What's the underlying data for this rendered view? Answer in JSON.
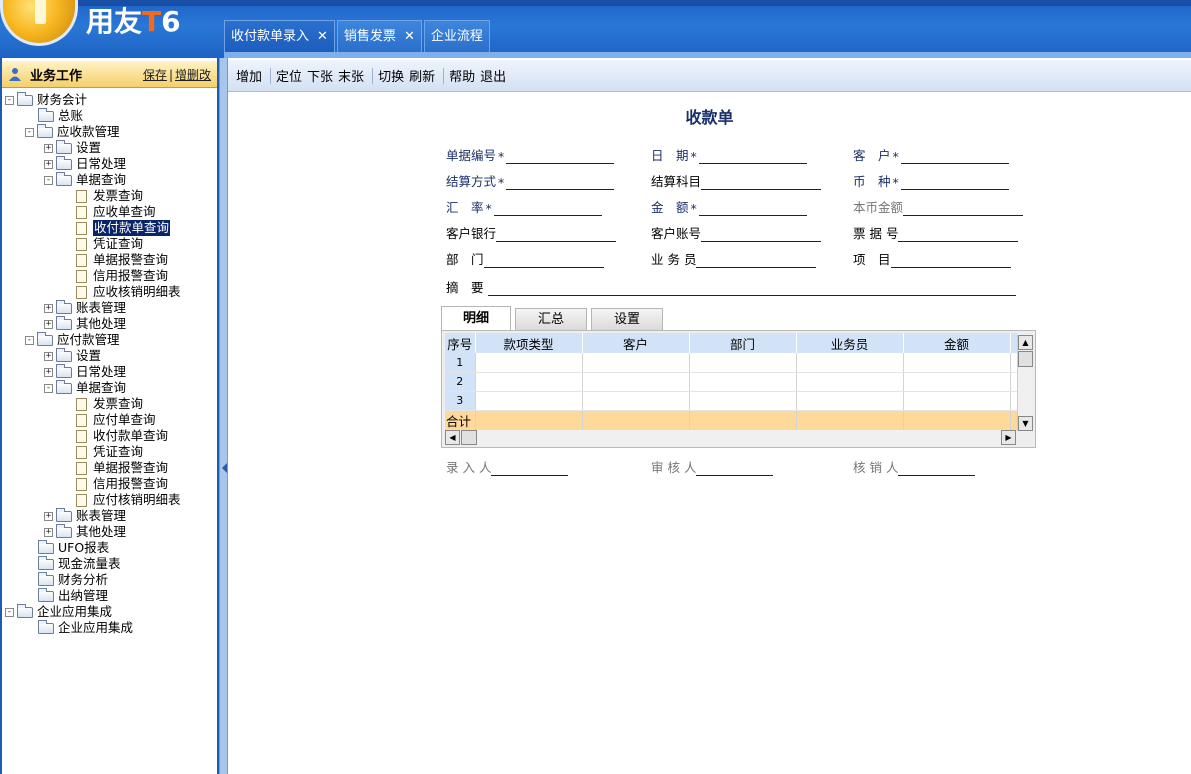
{
  "logo": {
    "brand_a": "用友",
    "brand_t": "T",
    "brand_6": "6"
  },
  "tabs": [
    {
      "label": "收付款单录入",
      "closable": true
    },
    {
      "label": "销售发票",
      "closable": true
    },
    {
      "label": "企业流程",
      "closable": false
    }
  ],
  "sidebar": {
    "title": "业务工作",
    "link_save": "保存",
    "link_edit": "增删改",
    "tree": [
      {
        "label": "财务会计",
        "exp": "-"
      },
      {
        "label": "总账"
      },
      {
        "label": "应收款管理",
        "exp": "-"
      },
      {
        "label": "设置",
        "exp": "+"
      },
      {
        "label": "日常处理",
        "exp": "+"
      },
      {
        "label": "单据查询",
        "exp": "-"
      },
      {
        "label": "发票查询"
      },
      {
        "label": "应收单查询"
      },
      {
        "label": "收付款单查询"
      },
      {
        "label": "凭证查询"
      },
      {
        "label": "单据报警查询"
      },
      {
        "label": "信用报警查询"
      },
      {
        "label": "应收核销明细表"
      },
      {
        "label": "账表管理",
        "exp": "+"
      },
      {
        "label": "其他处理",
        "exp": "+"
      },
      {
        "label": "应付款管理",
        "exp": "-"
      },
      {
        "label": "设置",
        "exp": "+"
      },
      {
        "label": "日常处理",
        "exp": "+"
      },
      {
        "label": "单据查询",
        "exp": "-"
      },
      {
        "label": "发票查询"
      },
      {
        "label": "应付单查询"
      },
      {
        "label": "收付款单查询"
      },
      {
        "label": "凭证查询"
      },
      {
        "label": "单据报警查询"
      },
      {
        "label": "信用报警查询"
      },
      {
        "label": "应付核销明细表"
      },
      {
        "label": "账表管理",
        "exp": "+"
      },
      {
        "label": "其他处理",
        "exp": "+"
      },
      {
        "label": "UFO报表"
      },
      {
        "label": "现金流量表"
      },
      {
        "label": "财务分析"
      },
      {
        "label": "出纳管理"
      },
      {
        "label": "企业应用集成",
        "exp": "-"
      },
      {
        "label": "企业应用集成"
      }
    ]
  },
  "toolbar": [
    "增加",
    "定位",
    "下张",
    "末张",
    "切换",
    "刷新",
    "帮助",
    "退出"
  ],
  "form": {
    "title": "收款单",
    "fields": {
      "bill_no": "单据编号",
      "date": "日　期",
      "customer": "客　户",
      "settle_method": "结算方式",
      "settle_subject": "结算科目",
      "currency": "币　种",
      "rate": "汇　率",
      "amount": "金　额",
      "local_amount": "本币金额",
      "cust_bank": "客户银行",
      "cust_account": "客户账号",
      "bill_number": "票 据 号",
      "dept": "部　门",
      "salesman": "业 务 员",
      "project": "项　目",
      "summary": "摘　要",
      "entered_by": "录 入 人",
      "audited_by": "审 核 人",
      "verified_by": "核 销 人"
    },
    "required_mark": "*",
    "detail_tabs": [
      "明细",
      "汇总",
      "设置"
    ],
    "grid": {
      "columns": [
        "序号",
        "款项类型",
        "客户",
        "部门",
        "业务员",
        "金额"
      ],
      "rows": [
        "1",
        "2",
        "3"
      ],
      "sum_label": "合计"
    }
  }
}
